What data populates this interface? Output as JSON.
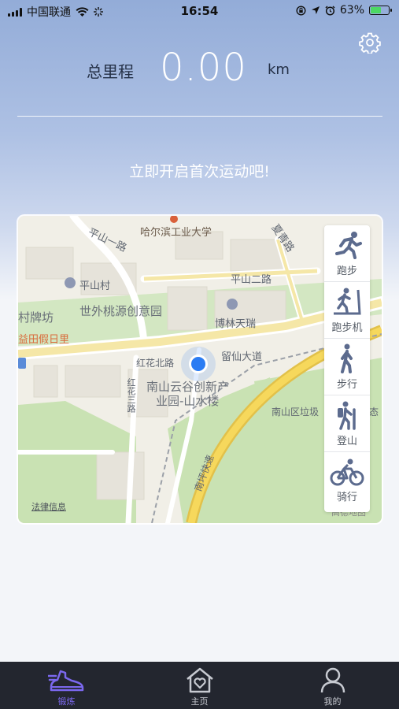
{
  "status_bar": {
    "carrier": "中国联通",
    "time": "16:54",
    "battery_percent": "63%",
    "battery_level": 0.63,
    "icons": [
      "signal-icon",
      "wifi-icon",
      "activity-icon",
      "orientation-lock-icon",
      "location-arrow-icon",
      "alarm-icon",
      "battery-icon"
    ]
  },
  "header": {
    "settings_icon": "gear-icon",
    "total_label": "总里程",
    "total_value": "0.00",
    "total_unit": "km",
    "prompt": "立即开启首次运动吧!"
  },
  "map": {
    "labels": {
      "univ": "哈尔滨工业大学",
      "pingshan_road1": "平山一路",
      "xiqing_road": "夏青路",
      "pingshan_village": "平山村",
      "pingshan_road2": "平山二路",
      "shiwai": "世外桃源创意园",
      "bolin": "博林天瑞",
      "paifang": "村牌坊",
      "yitian": "益田假日里",
      "honghua_north": "红花北路",
      "liuxian": "留仙大道",
      "honghua3": "红花三路",
      "nanshan_line1": "南山云谷创新产",
      "nanshan_line2": "业园-山水楼",
      "garbage": "南山区垃圾",
      "gutan": "态",
      "expressway": "南坪快速",
      "amap": "高德地图"
    },
    "legal_link": "法律信息",
    "sport_modes": [
      {
        "label": "跑步",
        "icon": "running-icon"
      },
      {
        "label": "跑步机",
        "icon": "treadmill-icon"
      },
      {
        "label": "步行",
        "icon": "walking-icon"
      },
      {
        "label": "登山",
        "icon": "hiking-icon"
      },
      {
        "label": "骑行",
        "icon": "cycling-icon"
      }
    ]
  },
  "tabbar": {
    "tabs": [
      {
        "label": "锻炼",
        "icon": "shoe-icon",
        "active": true
      },
      {
        "label": "主页",
        "icon": "home-heart-icon",
        "active": false
      },
      {
        "label": "我的",
        "icon": "person-icon",
        "active": false
      }
    ],
    "active_color": "#7b68ee",
    "inactive_color": "#c7cad1"
  }
}
